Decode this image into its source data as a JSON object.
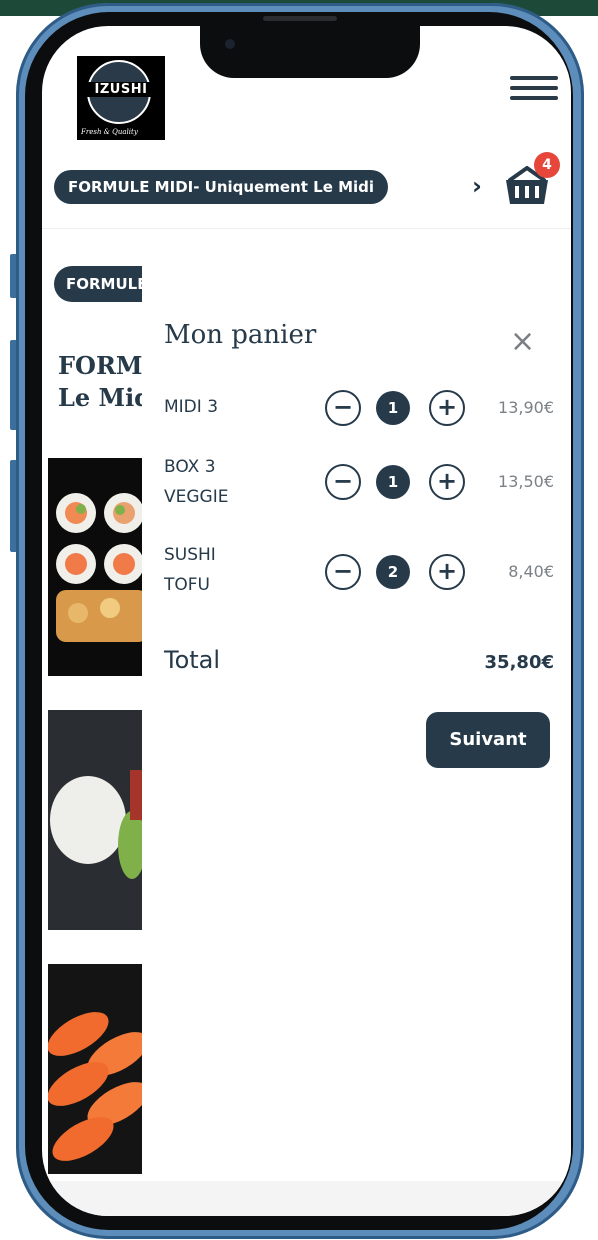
{
  "header": {
    "logo_text": "IZUSHI",
    "logo_subtitle": "Fresh & Quality"
  },
  "category_bar": {
    "active_category": "FORMULE MIDI- Uniquement Le Midi",
    "cart_count": "4"
  },
  "background_page": {
    "pill_text": "FORMULE MIDI",
    "title_line1": "FORMULE MIDI",
    "title_line2": "Le Midi"
  },
  "cart": {
    "title": "Mon panier",
    "close_label": "×",
    "items": [
      {
        "name": "MIDI 3",
        "qty": "1",
        "price": "13,90€"
      },
      {
        "name": "BOX 3 VEGGIE",
        "qty": "1",
        "price": "13,50€"
      },
      {
        "name": "SUSHI TOFU",
        "qty": "2",
        "price": "8,40€"
      }
    ],
    "total_label": "Total",
    "total_value": "35,80€",
    "next_label": "Suivant"
  },
  "colors": {
    "primary": "#263a4a",
    "badge": "#e7463a",
    "frame": "#5d8dbb"
  }
}
